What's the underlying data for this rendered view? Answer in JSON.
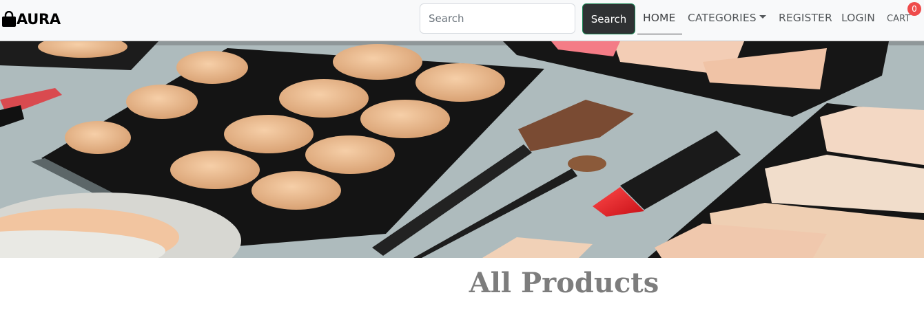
{
  "brand": {
    "name": "AURA",
    "icon": "shopping-bag-icon"
  },
  "search": {
    "placeholder": "Search",
    "value": "",
    "button_label": "Search"
  },
  "nav": {
    "home": "HOME",
    "categories": "CATEGORIES",
    "register": "REGISTER",
    "login": "LOGIN",
    "cart": "CART",
    "cart_count": "0"
  },
  "banner": {
    "image": "makeup-palette-banner",
    "alt": ""
  },
  "main": {
    "heading": "All Products"
  },
  "colors": {
    "navbar_bg": "#f8f9fa",
    "search_button_bg": "#2f3133",
    "search_button_border": "#198754",
    "cart_badge": "#ef4b4b",
    "heading": "#7d7d7d"
  }
}
